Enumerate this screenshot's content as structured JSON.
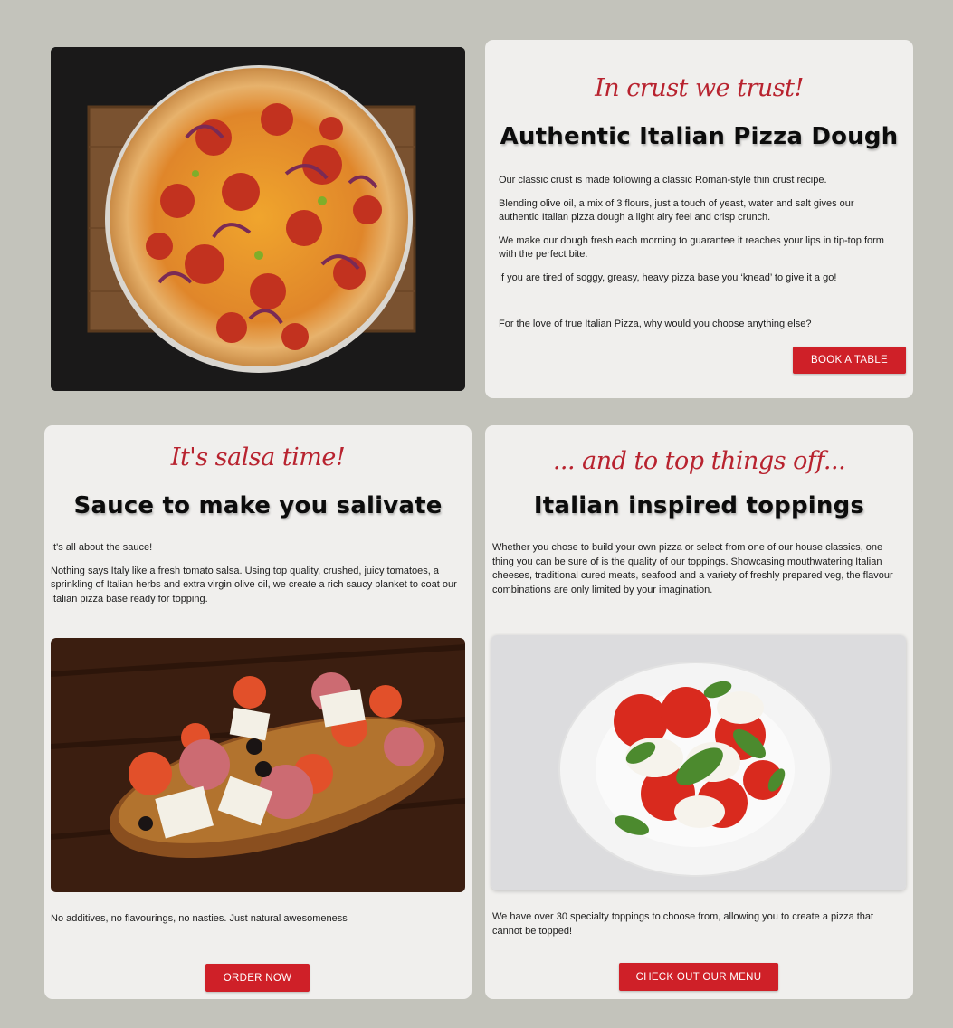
{
  "dough": {
    "tagline": "In crust we trust!",
    "title": "Authentic Italian Pizza Dough",
    "paragraphs": [
      "Our classic crust is made following a classic Roman-style thin crust recipe.",
      "Blending olive oil, a mix of 3 flours, just a touch of yeast, water and salt gives our authentic Italian pizza dough a light airy feel and crisp crunch.",
      "We make our dough fresh each morning to guarantee it reaches your lips in tip-top form with the perfect bite.",
      "If you are tired of soggy, greasy, heavy pizza base you ‘knead’ to give it a go!"
    ],
    "closing": "For the love of true Italian Pizza, why would you choose anything else?",
    "button": "BOOK A TABLE"
  },
  "sauce": {
    "tagline": "It's salsa time!",
    "title": "Sauce to make you salivate",
    "paragraphs": [
      "It's all about the sauce!",
      "Nothing says Italy like a fresh tomato salsa. Using top quality, crushed, juicy tomatoes, a sprinkling of Italian herbs and extra virgin olive oil, we create a rich saucy blanket to coat our Italian pizza base ready for topping."
    ],
    "footer": "No additives, no flavourings, no nasties. Just natural awesomeness",
    "button": "ORDER NOW"
  },
  "toppings": {
    "tagline": "... and to top things off...",
    "title": "Italian inspired toppings",
    "paragraphs": [
      "Whether you chose to build your own pizza or select from one of our house classics, one thing you can be sure of is the quality of our toppings. Showcasing mouthwatering Italian cheeses, traditional cured meats, seafood and a variety of freshly prepared veg, the flavour combinations are only limited by your imagination."
    ],
    "footer": "We have over 30 specialty toppings to choose from, allowing you to create a pizza that cannot be topped!",
    "button": "CHECK OUT OUR MENU"
  },
  "colors": {
    "accent": "#cf2028",
    "script": "#b8232f",
    "background": "#c3c3bb",
    "card": "#f0efed"
  }
}
